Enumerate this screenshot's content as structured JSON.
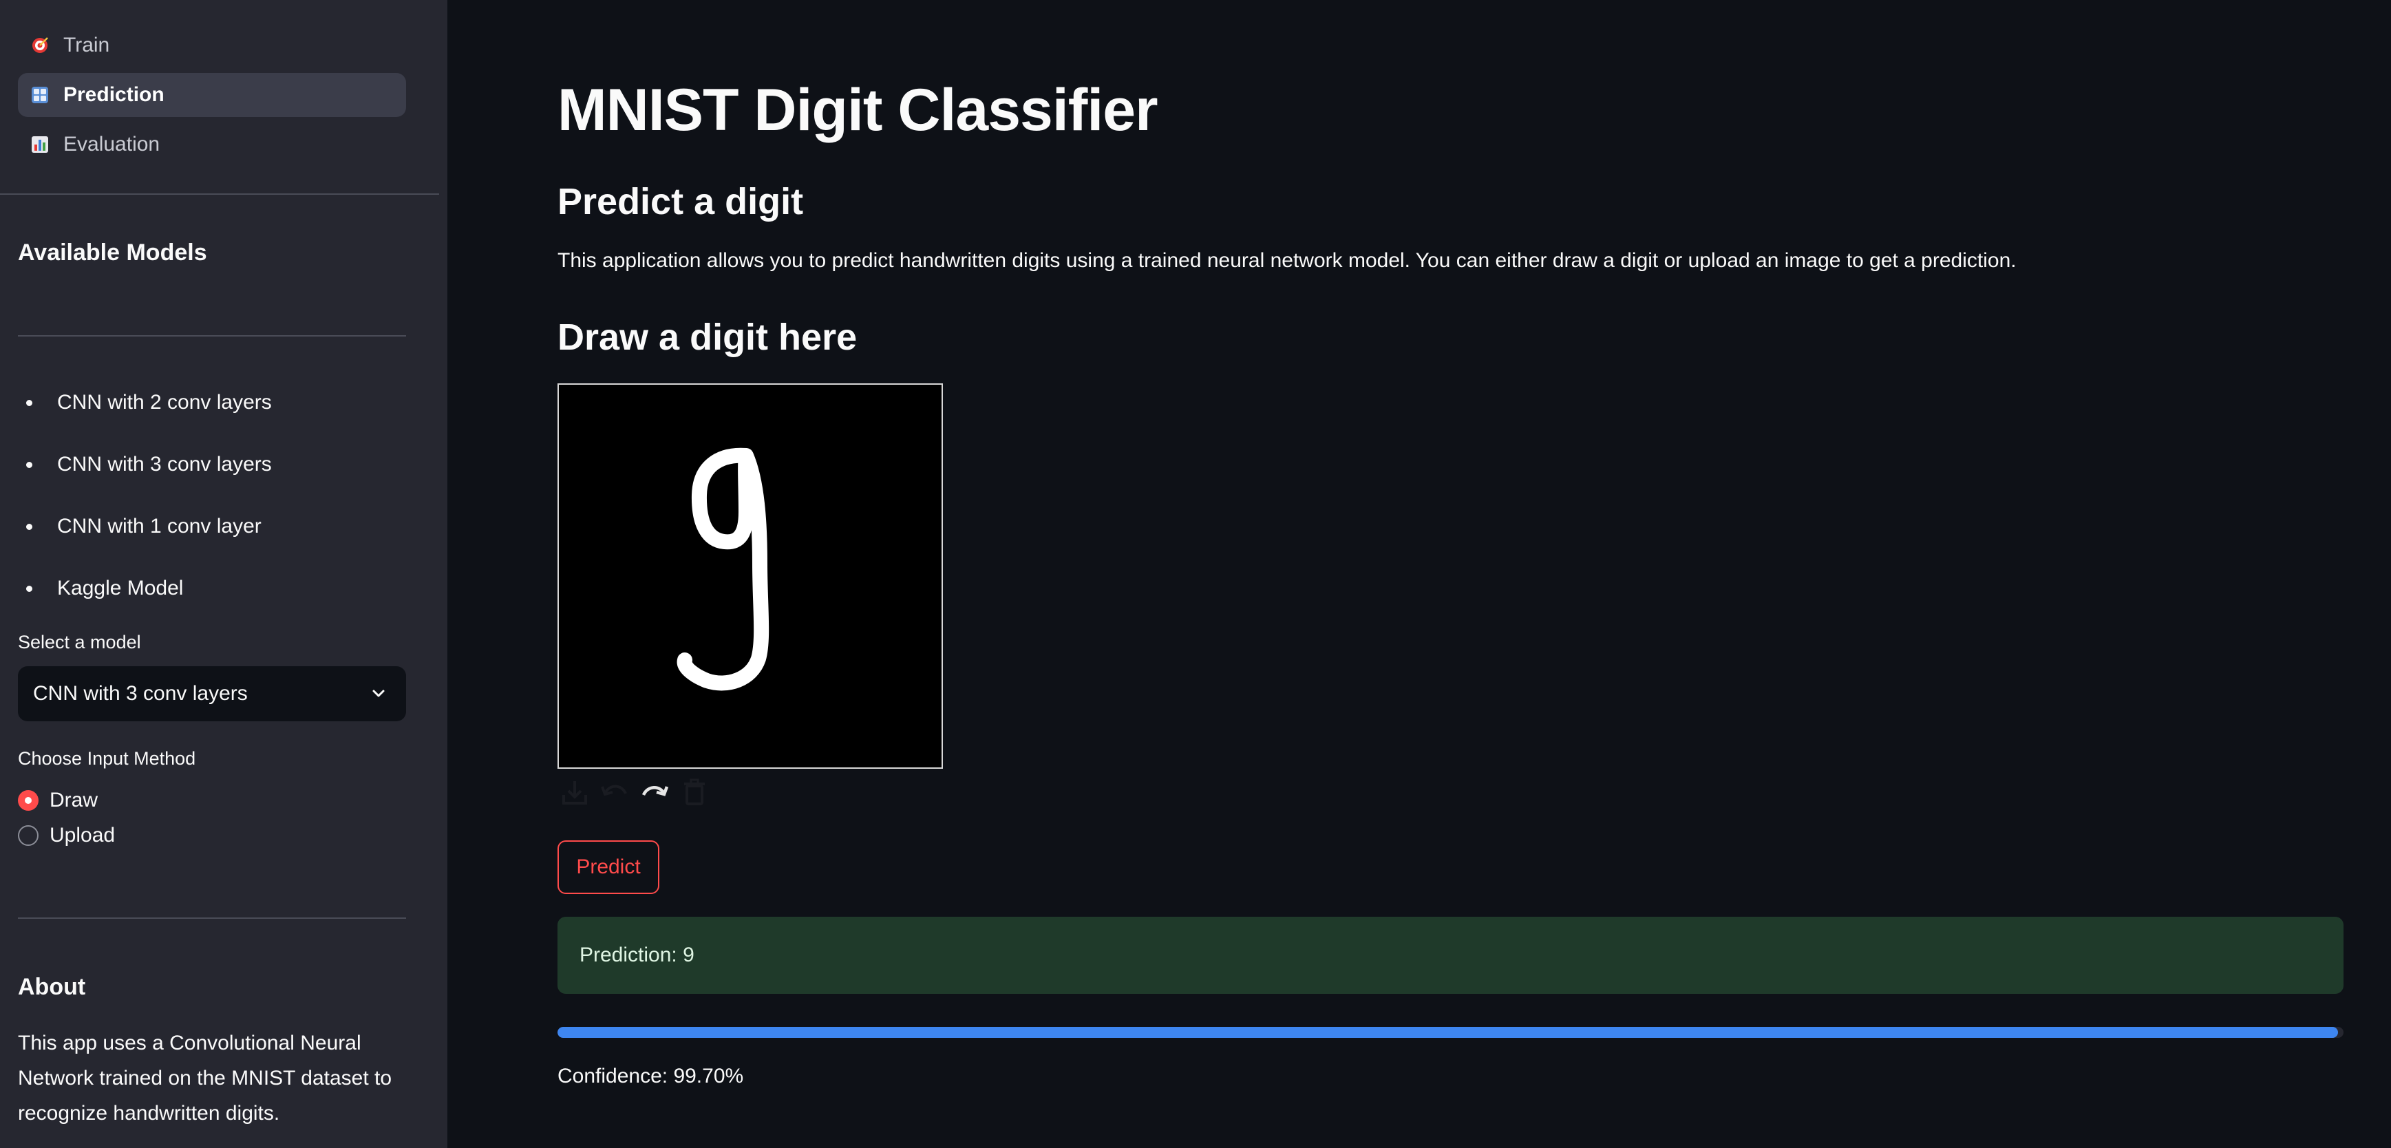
{
  "sidebar": {
    "nav": [
      {
        "label": "Train",
        "icon": "dart-target-icon",
        "active": false
      },
      {
        "label": "Prediction",
        "icon": "number-input-icon",
        "active": true
      },
      {
        "label": "Evaluation",
        "icon": "bar-chart-icon",
        "active": false
      }
    ],
    "available_models_title": "Available Models",
    "models": [
      "CNN with 2 conv layers",
      "CNN with 3 conv layers",
      "CNN with 1 conv layer",
      "Kaggle Model"
    ],
    "select_label": "Select a model",
    "select_value": "CNN with 3 conv layers",
    "input_method_label": "Choose Input Method",
    "input_methods": [
      {
        "label": "Draw",
        "checked": true
      },
      {
        "label": "Upload",
        "checked": false
      }
    ],
    "about_title": "About",
    "about_text": "This app uses a Convolutional Neural Network trained on the MNIST dataset to recognize handwritten digits."
  },
  "main": {
    "title": "MNIST Digit Classifier",
    "predict_header": "Predict a digit",
    "description": "This application allows you to predict handwritten digits using a trained neural network model. You can either draw a digit or upload an image to get a prediction.",
    "draw_header": "Draw a digit here",
    "predict_button": "Predict",
    "prediction_text": "Prediction: 9",
    "confidence_fraction": 0.997,
    "confidence_text": "Confidence: 99.70%"
  },
  "colors": {
    "sidebar_bg": "#262730",
    "main_bg": "#0e1117",
    "accent": "#ff4b4b",
    "success_bg": "#1f3a2a",
    "progress": "#3e86f0"
  }
}
